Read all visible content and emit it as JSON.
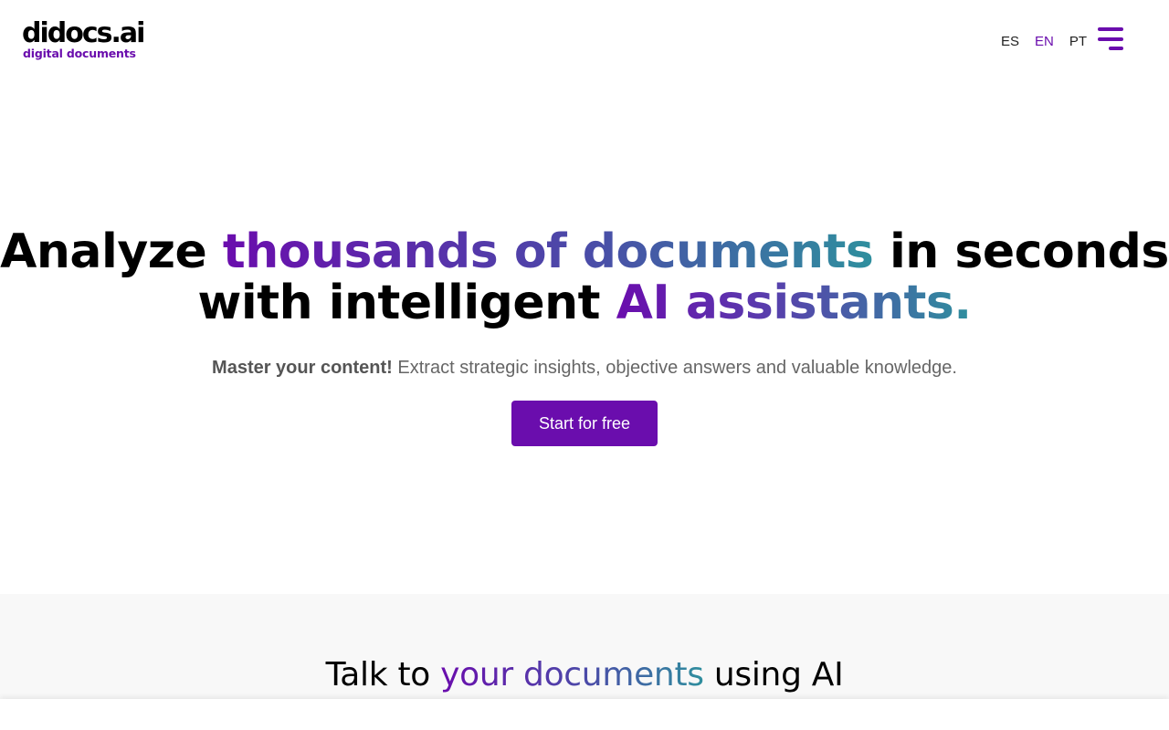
{
  "header": {
    "logo_text": "didocs.ai",
    "logo_subtitle": "digital documents",
    "languages": [
      {
        "code": "ES",
        "active": false
      },
      {
        "code": "EN",
        "active": true
      },
      {
        "code": "PT",
        "active": false
      }
    ],
    "menu_icon": "hamburger-menu-icon"
  },
  "hero": {
    "title_part1": "Analyze ",
    "title_highlight1": "thousands of documents",
    "title_part2": " in seconds with intelligent ",
    "title_highlight2": "AI assistants.",
    "subtitle_bold": "Master your content!",
    "subtitle_rest": " Extract strategic insights, objective answers and valuable knowledge.",
    "cta_label": "Start for free"
  },
  "section2": {
    "title_part1": "Talk to ",
    "title_highlight": "your documents",
    "title_part2": " using AI"
  },
  "colors": {
    "brand_purple": "#6a0dad",
    "gradient_teal": "#2f8f9e",
    "section_bg": "#f8f8f8"
  }
}
